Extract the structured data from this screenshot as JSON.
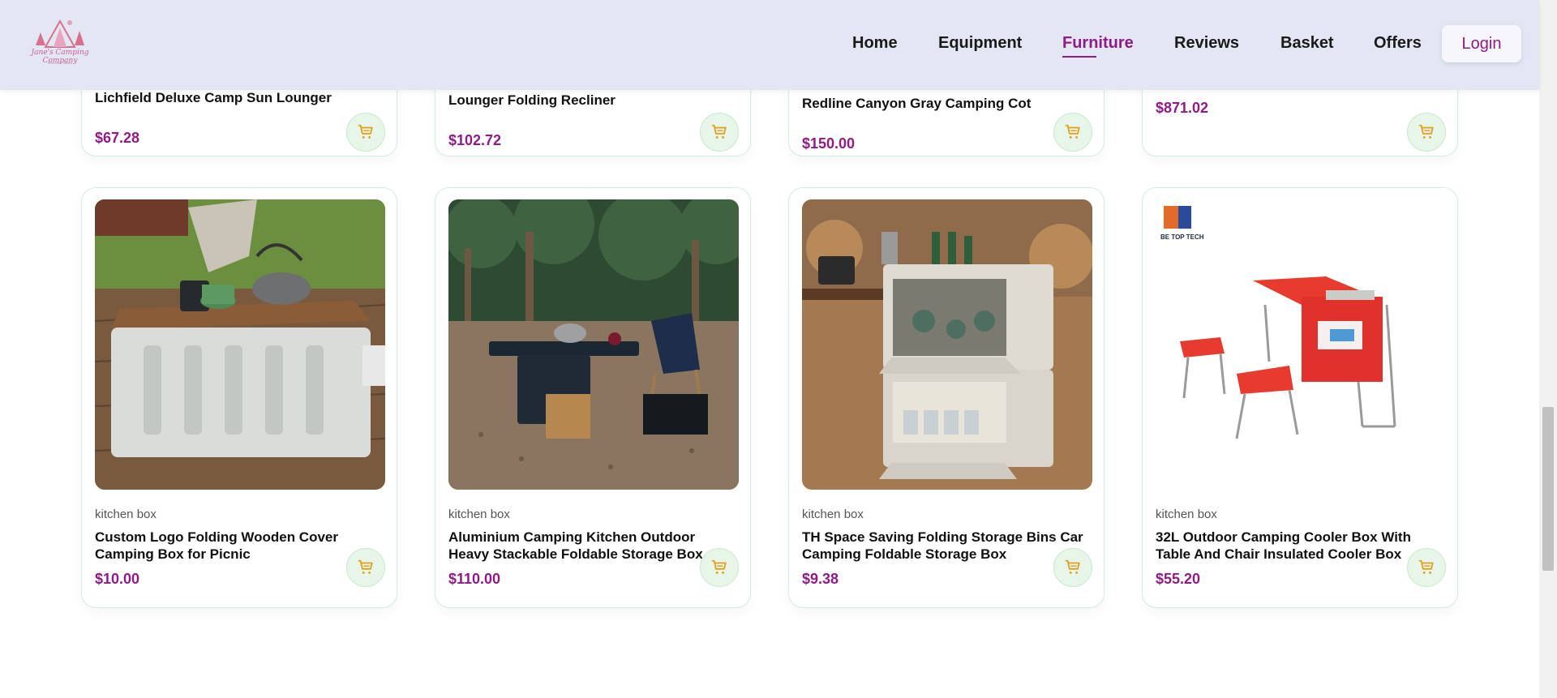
{
  "brand": {
    "logo_text": "Jane's Camping Company",
    "logo_sub": "Adventure Awaits"
  },
  "nav": {
    "items": [
      {
        "label": "Home"
      },
      {
        "label": "Equipment"
      },
      {
        "label": "Furniture",
        "active": true
      },
      {
        "label": "Reviews"
      },
      {
        "label": "Basket"
      },
      {
        "label": "Offers"
      }
    ],
    "login": "Login"
  },
  "colors": {
    "accent": "#8e1b86",
    "header_bg": "#e3e7f3",
    "cart_icon": "#e0a020"
  },
  "top_row": [
    {
      "title": "Lichfield Deluxe Camp Sun Lounger",
      "price": "$67.28"
    },
    {
      "title": "Lounger Folding Recliner",
      "price": "$102.72"
    },
    {
      "title": "Redline Canyon Gray Camping Cot",
      "price": "$150.00"
    },
    {
      "title": "",
      "price": "$871.02"
    }
  ],
  "products": [
    {
      "category": "kitchen box",
      "title_1": "Custom Logo Folding Wooden Cover",
      "title_2": "Camping Box for Picnic",
      "price": "$10.00"
    },
    {
      "category": "kitchen box",
      "title_1": "Aluminium Camping Kitchen Outdoor",
      "title_2": "Heavy Stackable Foldable Storage Box",
      "price": "$110.00"
    },
    {
      "category": "kitchen box",
      "title_1": "TH Space Saving Folding Storage Bins Car",
      "title_2": "Camping Foldable Storage Box",
      "price": "$9.38"
    },
    {
      "category": "kitchen box",
      "title_1": "32L Outdoor Camping Cooler Box With",
      "title_2": "Table And Chair Insulated Cooler Box",
      "price": "$55.20",
      "brand_text": "BE TOP TECH"
    }
  ],
  "icons": {
    "cart": "cart-icon"
  }
}
